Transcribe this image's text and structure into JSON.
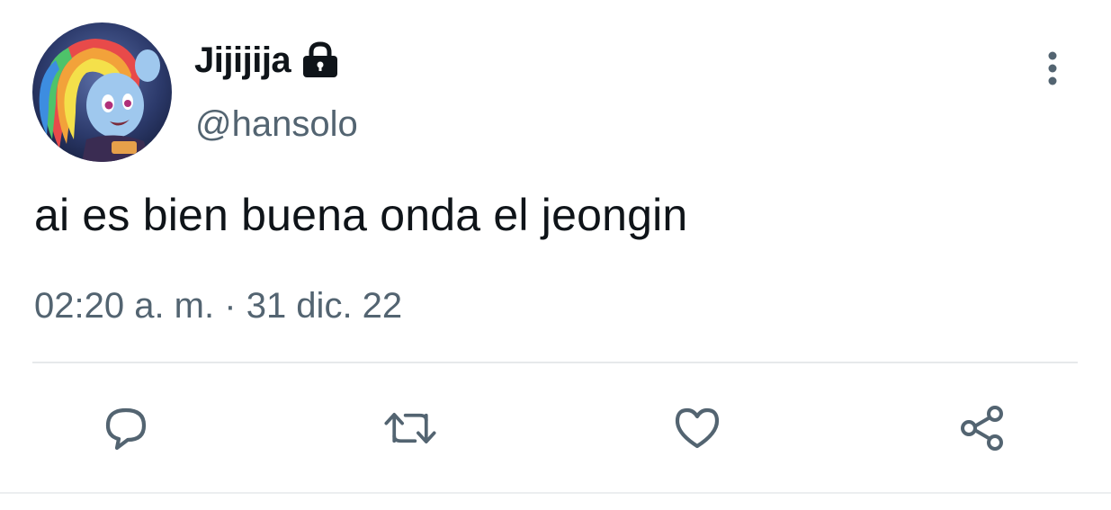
{
  "tweet": {
    "display_name": "Jijijija",
    "handle": "@hansolo",
    "text": "ai es bien buena onda el jeongin",
    "time": "02:20 a. m.",
    "separator": "·",
    "date": "31 dic. 22"
  },
  "icons": {
    "lock": "lock-icon",
    "more": "more-vertical-icon",
    "reply": "reply-icon",
    "retweet": "retweet-icon",
    "like": "heart-icon",
    "share": "share-icon"
  },
  "colors": {
    "text_primary": "#0f1419",
    "text_secondary": "#536471",
    "divider": "#e6e9eb"
  }
}
